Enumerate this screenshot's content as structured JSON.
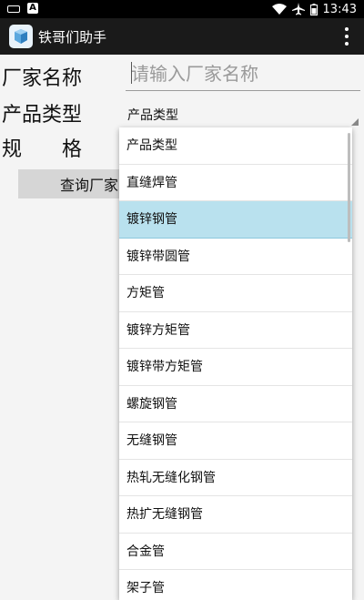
{
  "status_bar": {
    "notification_icons": [
      "keyboard-icon",
      "a-icon"
    ],
    "a_label": "A",
    "time": "13:43"
  },
  "app_bar": {
    "title": "铁哥们助手"
  },
  "form": {
    "vendor_label": "厂家名称",
    "vendor_placeholder": "请输入厂家名称",
    "vendor_value": "",
    "type_label": "产品类型",
    "type_selected": "产品类型",
    "spec_label": "规格",
    "query_button": "查询厂家"
  },
  "dropdown": {
    "selected_index": 2,
    "items": [
      "产品类型",
      "直缝焊管",
      "镀锌钢管",
      "镀锌带圆管",
      "方矩管",
      "镀锌方矩管",
      "镀锌带方矩管",
      "螺旋钢管",
      "无缝钢管",
      "热轧无缝化钢管",
      "热扩无缝钢管",
      "合金管",
      "架子管"
    ]
  },
  "colors": {
    "status_bar_bg": "#000000",
    "app_bar_bg": "#1a1a1a",
    "selected_item_bg": "#b9e1ee",
    "button_bg": "#d6d6d6"
  }
}
